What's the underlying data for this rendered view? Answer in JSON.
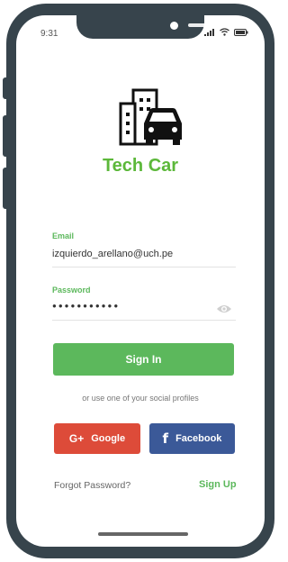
{
  "status_bar": {
    "time": "9:31"
  },
  "app": {
    "name": "Tech Car"
  },
  "form": {
    "email_label": "Email",
    "email_value": "izquierdo_arellano@uch.pe",
    "password_label": "Password",
    "password_masked": "●●●●●●●●●●●"
  },
  "buttons": {
    "sign_in": "Sign In",
    "google": "Google",
    "facebook": "Facebook"
  },
  "social_text": "or use one of your social profiles",
  "links": {
    "forgot_password": "Forgot Password?",
    "sign_up": "Sign Up"
  },
  "icons": {
    "logo": "car-building-logo",
    "eye": "eye-icon",
    "google": "google-plus-icon",
    "facebook": "facebook-icon"
  },
  "colors": {
    "primary_green": "#5cb85c",
    "google_red": "#dd4b39",
    "facebook_blue": "#3b5998",
    "frame": "#37444c"
  }
}
